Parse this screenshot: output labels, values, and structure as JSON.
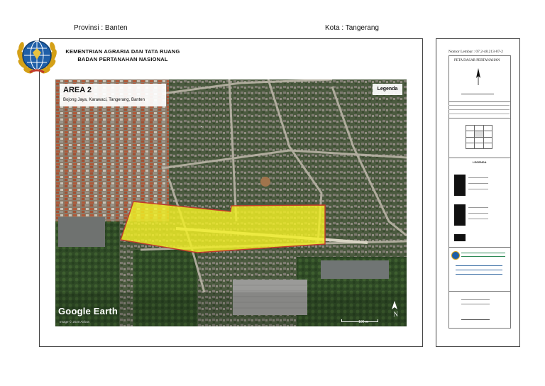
{
  "header": {
    "province": "Provinsi : Banten",
    "city": "Kota : Tangerang",
    "institution_line1": "KEMENTRIAN AGRARIA DAN TATA RUANG",
    "institution_line2": "BADAN PERTANAHAN NASIONAL"
  },
  "map": {
    "area_title": "AREA 2",
    "area_location": "Bojong Jaya, Karawaci, Tangerang, Banten",
    "legend_button": "Legenda",
    "watermark": "Google Earth",
    "credit": "Image © 2020 Airbus",
    "scale_label": "100 m",
    "north_label": "N",
    "highlight_color": "#f2ef24",
    "outline_color": "#c0392b"
  },
  "sidebar": {
    "sheet_number": "Nomor Lembar :  07.2-48.213-07-2",
    "map_title": "PETA DASAR PERTANAHAN",
    "legend_heading": "LEGENDA"
  }
}
